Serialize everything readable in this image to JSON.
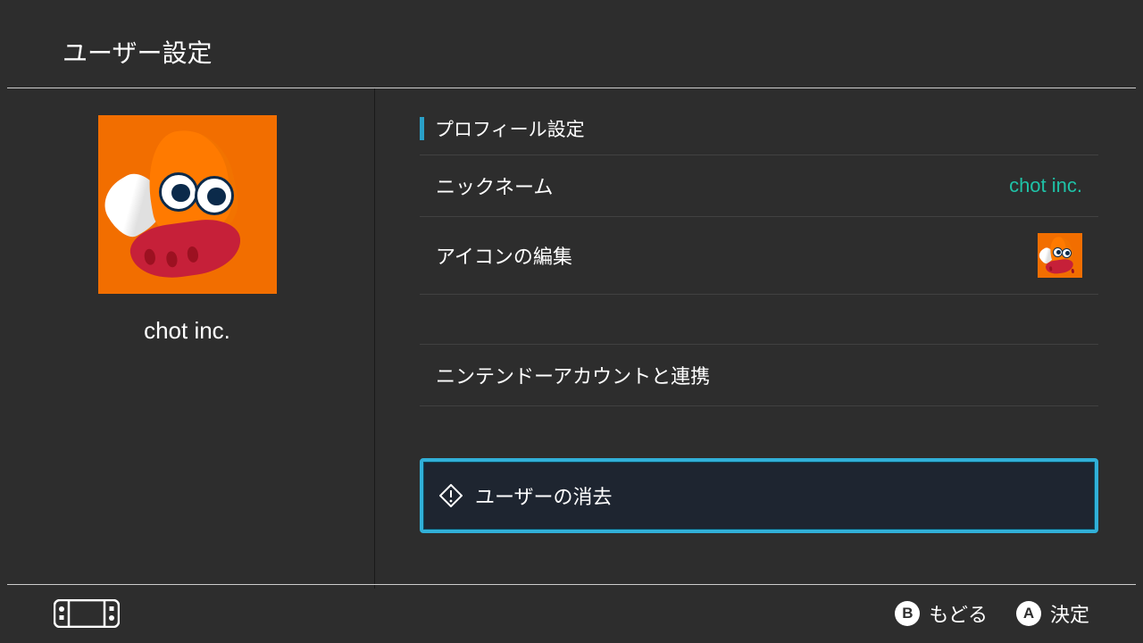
{
  "header": {
    "title": "ユーザー設定"
  },
  "user": {
    "name": "chot inc.",
    "avatar_icon": "squid-orange"
  },
  "profile": {
    "section_title": "プロフィール設定",
    "nickname_label": "ニックネーム",
    "nickname_value": "chot inc.",
    "icon_edit_label": "アイコンの編集",
    "link_account_label": "ニンテンドーアカウントと連携",
    "delete_label": "ユーザーの消去"
  },
  "footer": {
    "b_label": "もどる",
    "a_label": "決定",
    "b_glyph": "B",
    "a_glyph": "A"
  },
  "colors": {
    "accent": "#31b0d8",
    "value": "#1fc2a7",
    "avatar_bg": "#f26e00"
  }
}
